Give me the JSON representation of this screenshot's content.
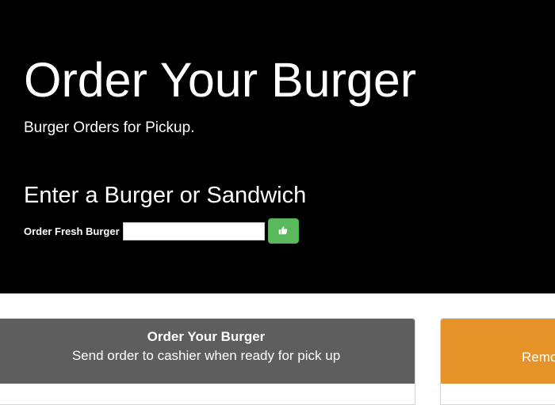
{
  "hero": {
    "title": "Order Your Burger",
    "subtitle": "Burger Orders for Pickup."
  },
  "form": {
    "heading": "Enter a Burger or Sandwich",
    "label": "Order Fresh Burger",
    "input_value": "",
    "input_placeholder": "",
    "submit_icon": "thumbs-up-icon",
    "submit_color": "#5cb85c"
  },
  "panels": {
    "order": {
      "title": "Order Your Burger",
      "subtitle": "Send order to cashier when ready for pick up",
      "header_color": "#5e5e5e"
    },
    "removed": {
      "subtitle": "Remo",
      "header_color": "#e59328"
    }
  }
}
